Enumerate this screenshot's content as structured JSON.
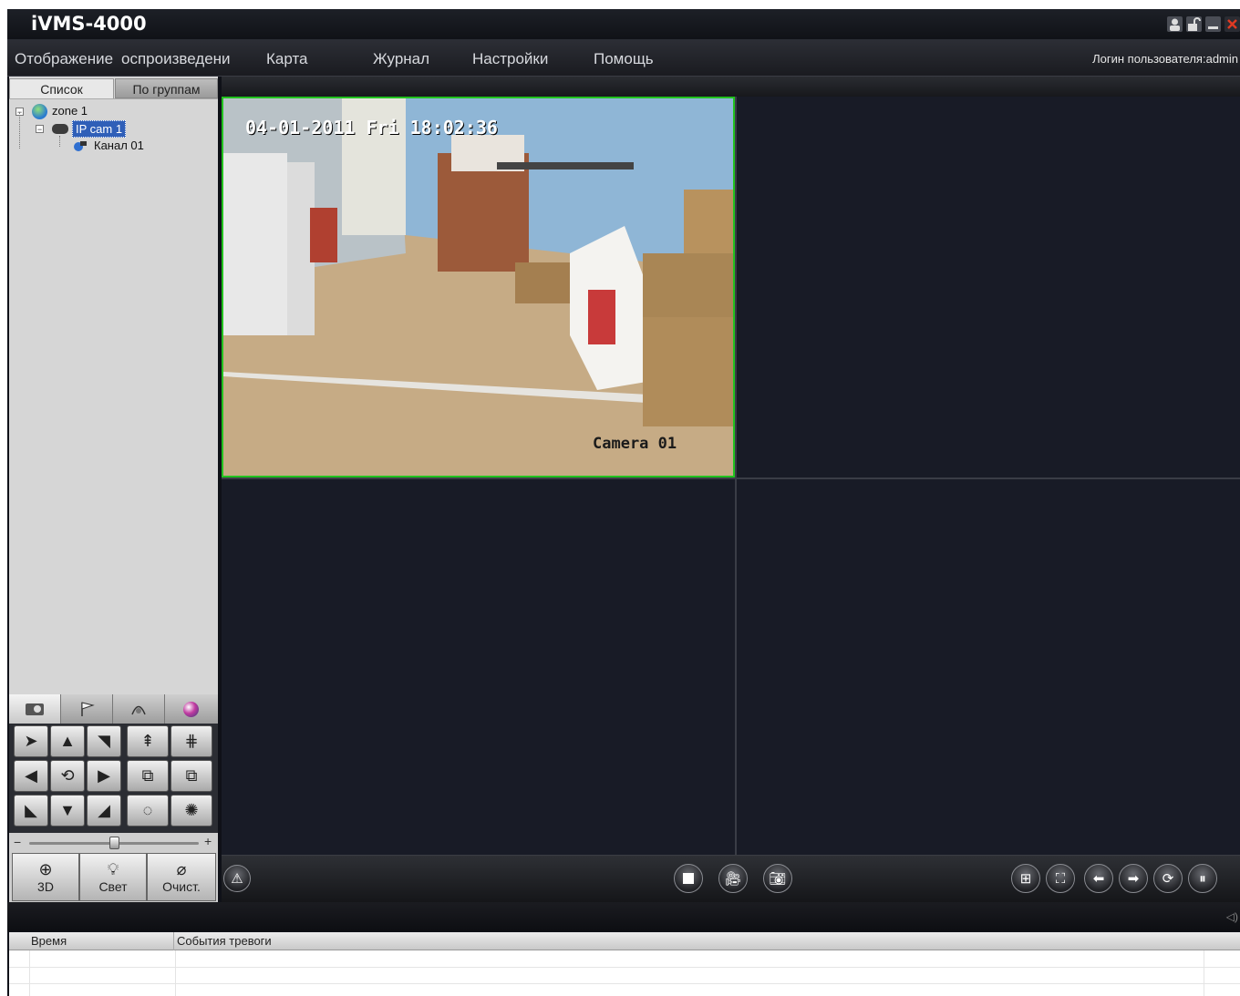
{
  "app": {
    "title": "iVMS-4000"
  },
  "menu": {
    "items": [
      "Отображение",
      "оспроизведени",
      "Карта",
      "Журнал",
      "Настройки",
      "Помощь"
    ],
    "login": "Логин пользователя:admin"
  },
  "sidebar": {
    "tabs": [
      "Список",
      "По группам"
    ],
    "tree": {
      "zone": "zone 1",
      "device": "IP cam 1",
      "channel": "Канал 01"
    }
  },
  "ptz": {
    "buttons": {
      "zoom3d": "3D",
      "light": "Свет",
      "clear": "Очист."
    }
  },
  "video": {
    "osd_timestamp": "04-01-2011 Fri 18:02:36",
    "osd_camera": "Camera 01"
  },
  "alarm": {
    "columns": [
      "Время",
      "События тревоги"
    ]
  },
  "colors": {
    "active_border": "#22c21f",
    "background": "#0f1118",
    "accent": "#d32b1e"
  }
}
